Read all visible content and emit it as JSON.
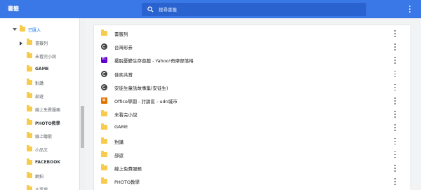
{
  "app": {
    "title": "書籤"
  },
  "search": {
    "placeholder": "搜尋書籤"
  },
  "sidebar": {
    "items": [
      {
        "label": "已匯入",
        "style": "blue",
        "caret": "down",
        "level": 1
      },
      {
        "label": "書籤列",
        "style": "normal",
        "caret": "right",
        "level": 2
      },
      {
        "label": "未看完小說",
        "style": "normal",
        "caret": "",
        "level": 2
      },
      {
        "label": "GAME",
        "style": "bold",
        "caret": "",
        "level": 2
      },
      {
        "label": "對講",
        "style": "normal",
        "caret": "",
        "level": 2
      },
      {
        "label": "部遊",
        "style": "normal",
        "caret": "",
        "level": 2
      },
      {
        "label": "線上免費服務",
        "style": "normal",
        "caret": "",
        "level": 2
      },
      {
        "label": "PHOTO教學",
        "style": "bold",
        "caret": "",
        "level": 2
      },
      {
        "label": "線上聽歌",
        "style": "normal",
        "caret": "",
        "level": 2
      },
      {
        "label": "小品文",
        "style": "normal",
        "caret": "",
        "level": 2
      },
      {
        "label": "FACEBOOK",
        "style": "bold",
        "caret": "",
        "level": 2
      },
      {
        "label": "網拍",
        "style": "normal",
        "caret": "",
        "level": 2
      },
      {
        "label": "大賣場",
        "style": "normal",
        "caret": "",
        "level": 2
      }
    ]
  },
  "list": {
    "rows": [
      {
        "label": "書籤列",
        "icon": "folder-icon"
      },
      {
        "label": "台灣彩券",
        "icon": "globe-icon"
      },
      {
        "label": "擺脫憂鬱生存遊戲 - Yahoo!奇摩部落格",
        "icon": "yahoo-icon"
      },
      {
        "label": "佳奕共賞",
        "icon": "globe-icon"
      },
      {
        "label": "安徒生童話故事集(安徒生)",
        "icon": "globe-icon"
      },
      {
        "label": "Office學園 - 討論區 - udn城市",
        "icon": "udn-icon"
      },
      {
        "label": "未看完小說",
        "icon": "folder-icon"
      },
      {
        "label": "GAME",
        "icon": "folder-icon"
      },
      {
        "label": "對講",
        "icon": "folder-icon"
      },
      {
        "label": "部遊",
        "icon": "folder-icon"
      },
      {
        "label": "線上免費服務",
        "icon": "folder-icon"
      },
      {
        "label": "PHOTO教學",
        "icon": "folder-icon"
      }
    ]
  }
}
